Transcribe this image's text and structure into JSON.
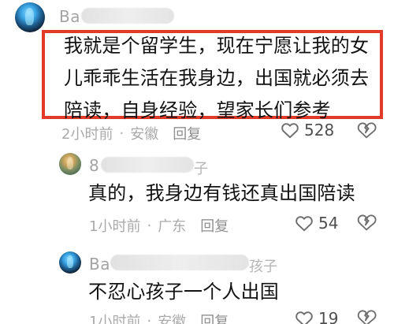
{
  "comments": [
    {
      "username_visible": "Ba",
      "text": "我就是个留学生，现在宁愿让我的女\n儿乖乖生活在我身边，出国就必须去\n陪读，自身经验，望家长们参考",
      "time": "2小时前",
      "location": "安徽",
      "reply_label": "回复",
      "likes": "528",
      "highlighted": true
    },
    {
      "username_visible": "8",
      "username_tail_visible": "子",
      "text": "真的，我身边有钱还真出国陪读",
      "time": "1小时前",
      "location": "广东",
      "reply_label": "回复",
      "likes": "54"
    },
    {
      "username_visible": "Ba",
      "username_tail_visible": "孩子",
      "text": "不忍心孩子一个人出国",
      "time": "1小时前",
      "location": "安徽",
      "reply_label": "回复",
      "likes": "19"
    }
  ],
  "colors": {
    "highlight_border": "#e13a28",
    "meta_text": "#aaaaaa",
    "body_text": "#121212"
  },
  "icons": {
    "like": "heart-icon",
    "dislike": "broken-heart-icon"
  }
}
